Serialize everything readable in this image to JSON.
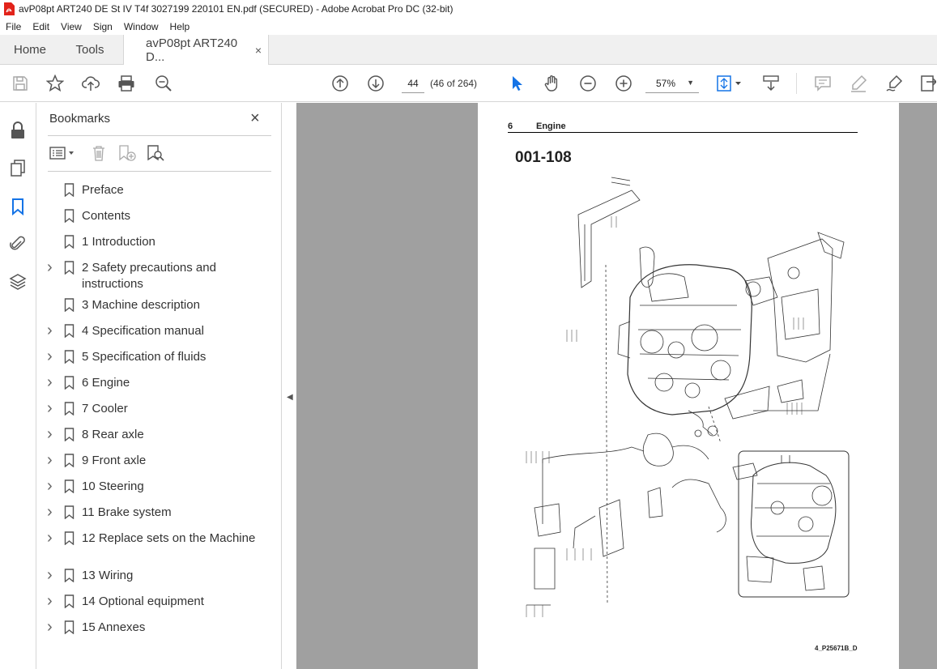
{
  "window": {
    "title": "avP08pt ART240 DE St IV T4f 3027199 220101 EN.pdf (SECURED) - Adobe Acrobat Pro DC (32-bit)"
  },
  "menu": [
    "File",
    "Edit",
    "View",
    "Sign",
    "Window",
    "Help"
  ],
  "tabs": {
    "home": "Home",
    "tools": "Tools",
    "document": "avP08pt ART240 D...",
    "close": "×"
  },
  "toolbar": {
    "page_current": "44",
    "page_of": "(46 of 264)",
    "zoom": "57%",
    "icons": [
      "save-icon",
      "star-icon",
      "upload-icon",
      "print-icon",
      "search-zoom-icon",
      "page-up-icon",
      "page-down-icon",
      "cursor-icon",
      "hand-icon",
      "zoom-out-icon",
      "zoom-in-icon",
      "fit-page-icon",
      "scroll-mode-icon",
      "comment-icon",
      "highlight-icon",
      "sign-icon",
      "share-icon"
    ]
  },
  "bookmarks": {
    "title": "Bookmarks",
    "close": "×",
    "items": [
      {
        "label": "Preface",
        "expandable": false
      },
      {
        "label": "Contents",
        "expandable": false
      },
      {
        "label": "1 Introduction",
        "expandable": false
      },
      {
        "label": "2 Safety precautions and instructions",
        "expandable": true
      },
      {
        "label": "3 Machine description",
        "expandable": false
      },
      {
        "label": "4 Specification manual",
        "expandable": true
      },
      {
        "label": "5 Specification of fluids",
        "expandable": true
      },
      {
        "label": "6 Engine",
        "expandable": true
      },
      {
        "label": "7 Cooler",
        "expandable": true
      },
      {
        "label": "8 Rear axle",
        "expandable": true
      },
      {
        "label": "9 Front axle",
        "expandable": true
      },
      {
        "label": "10 Steering",
        "expandable": true
      },
      {
        "label": "11 Brake system",
        "expandable": true
      },
      {
        "label": "12 Replace sets on the Machine",
        "expandable": true
      },
      {
        "label": "13 Wiring",
        "expandable": true
      },
      {
        "label": "14 Optional equipment",
        "expandable": true
      },
      {
        "label": "15 Annexes",
        "expandable": true
      }
    ]
  },
  "document_page": {
    "section_number": "6",
    "section_title": "Engine",
    "drawing_code": "001-108",
    "figure_ref": "4_P25671B_D"
  },
  "colors": {
    "accent": "#1473e6",
    "viewer_bg": "#a0a0a0",
    "pdf_red": "#e2231a"
  }
}
